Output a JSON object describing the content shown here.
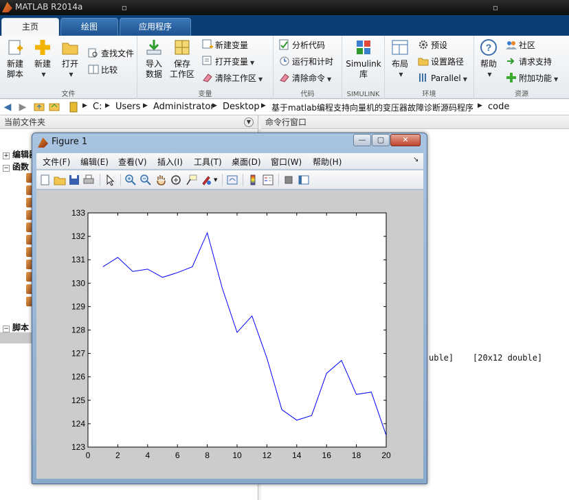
{
  "app": {
    "title": "MATLAB R2014a"
  },
  "tabs": [
    {
      "label": "主页"
    },
    {
      "label": "绘图"
    },
    {
      "label": "应用程序"
    }
  ],
  "ribbon": {
    "file_group": {
      "label": "文件",
      "new_script": "新建\n脚本",
      "new": "新建",
      "open": "打开",
      "find_files": "查找文件",
      "compare": "比较"
    },
    "variable_group": {
      "label": "变量",
      "import_data": "导入\n数据",
      "save_workspace": "保存\n工作区",
      "new_variable": "新建变量",
      "open_variable": "打开变量",
      "clear_workspace": "清除工作区"
    },
    "code_group": {
      "label": "代码",
      "analyze_code": "分析代码",
      "run_and_time": "运行和计时",
      "clear_commands": "清除命令"
    },
    "simulink_group": {
      "label": "SIMULINK",
      "library": "Simulink\n库"
    },
    "environment_group": {
      "label": "环境",
      "layout": "布局",
      "preferences": "预设",
      "set_path": "设置路径",
      "parallel": "Parallel"
    },
    "resources_group": {
      "label": "资源",
      "help": "帮助",
      "community": "社区",
      "request_support": "请求支持",
      "addons": "附加功能"
    }
  },
  "address": {
    "crumbs": [
      "C:",
      "Users",
      "Administrator",
      "Desktop",
      "基于matlab编程支持向量机的变压器故障诊断源码程序",
      "code"
    ]
  },
  "current_folder": {
    "header": "当前文件夹",
    "sections": [
      {
        "label": "编辑器"
      },
      {
        "label": "函数"
      },
      {
        "label": "脚本"
      }
    ]
  },
  "command_window": {
    "header": "命令行窗口",
    "visible_fragments": [
      "uble]",
      "[20x12 double]"
    ]
  },
  "figure": {
    "title": "Figure 1",
    "menu": [
      "文件(F)",
      "编辑(E)",
      "查看(V)",
      "插入(I)",
      "工具(T)",
      "桌面(D)",
      "窗口(W)",
      "帮助(H)"
    ],
    "toolbar_icons": [
      "new-figure-icon",
      "open-icon",
      "save-icon",
      "print-icon",
      "select-arrow-icon",
      "zoom-in-icon",
      "zoom-out-icon",
      "pan-hand-icon",
      "rotate-3d-icon",
      "data-cursor-icon",
      "brush-icon",
      "link-plot-icon",
      "colorbar-icon",
      "legend-icon",
      "hide-plot-tools-icon",
      "show-plot-tools-icon"
    ]
  },
  "chart_data": {
    "type": "line",
    "x": [
      1,
      2,
      3,
      4,
      5,
      6,
      7,
      8,
      9,
      10,
      11,
      12,
      13,
      14,
      15,
      16,
      17,
      18,
      19,
      20
    ],
    "series": [
      {
        "color": "#0000ff",
        "values": [
          130.7,
          131.1,
          130.5,
          130.6,
          130.25,
          130.45,
          130.7,
          132.15,
          129.8,
          127.9,
          128.6,
          126.8,
          124.6,
          124.15,
          124.35,
          126.15,
          126.7,
          125.25,
          125.35,
          123.5
        ]
      }
    ],
    "xlim": [
      0,
      20
    ],
    "ylim": [
      123,
      133
    ],
    "xticks": [
      0,
      2,
      4,
      6,
      8,
      10,
      12,
      14,
      16,
      18,
      20
    ],
    "yticks": [
      123,
      124,
      125,
      126,
      127,
      128,
      129,
      130,
      131,
      132,
      133
    ],
    "grid": false
  }
}
